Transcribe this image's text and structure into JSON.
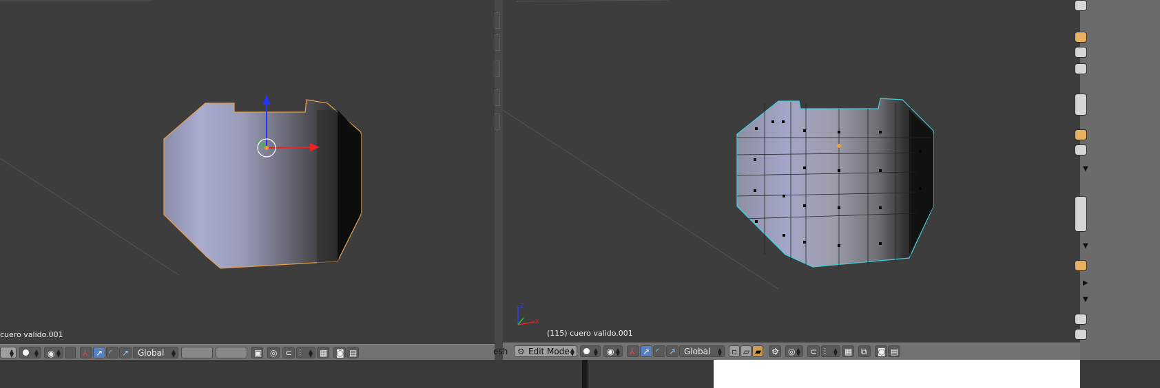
{
  "left_viewport": {
    "object_label": "cuero valido.001"
  },
  "right_viewport": {
    "object_label": "(115) cuero valido.001",
    "axis_labels": [
      "Z",
      "X",
      "Y"
    ]
  },
  "left_header": {
    "orientation": "Global",
    "pivot_icon": "pivot-icon",
    "manipulator_icons": [
      "translate-icon",
      "rotate-icon",
      "scale-icon"
    ]
  },
  "right_header": {
    "editor_stub": "esh",
    "mode": "Edit Mode",
    "orientation": "Global"
  },
  "colors": {
    "accent": "#5680c2",
    "selection_outline": "#e8a14a",
    "edit_wire": "#3fd0e0"
  }
}
